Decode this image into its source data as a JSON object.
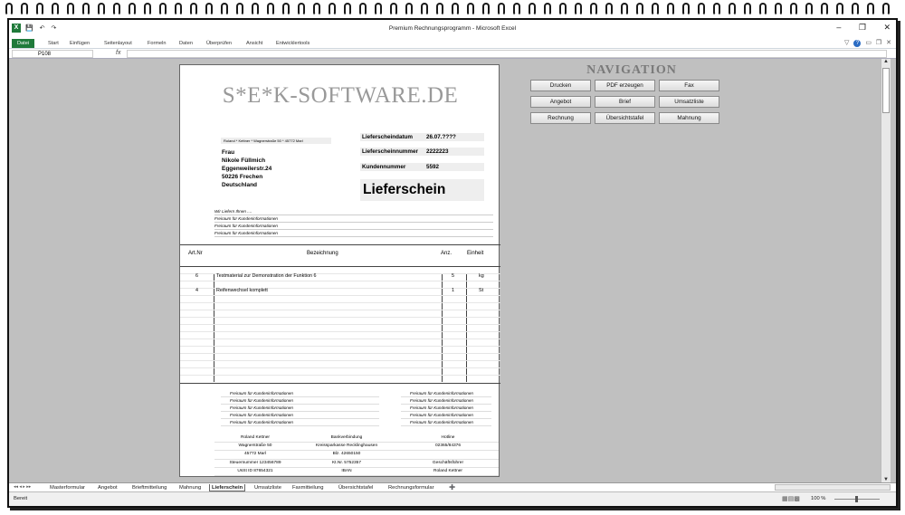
{
  "window": {
    "title": "Premium Rechnungsprogramm  -  Microsoft Excel",
    "app_icon": "X",
    "qat": [
      "save-icon",
      "undo-icon",
      "redo-icon"
    ],
    "controls": [
      "–",
      "❐",
      "✕"
    ]
  },
  "ribbon": {
    "tabs": [
      "Datei",
      "Start",
      "Einfügen",
      "Seitenlayout",
      "Formeln",
      "Daten",
      "Überprüfen",
      "Ansicht",
      "Entwicklertools"
    ],
    "active": "Datei"
  },
  "formula_bar": {
    "name_box": "P108",
    "fx": "fx",
    "value": ""
  },
  "sheet": {
    "logo": "S*E*K-SOFTWARE.DE",
    "sender_line": "Roland * Kettner * Wagnerstraße 50 * 45772 Marl",
    "recipient": [
      "Frau",
      "Nikole Füllmich",
      "Eggenweilerstr.24",
      "50226 Frechen",
      "Deutschland"
    ],
    "info": [
      {
        "label": "Lieferscheindatum",
        "value": "26.07.????"
      },
      {
        "label": "Lieferscheinnummer",
        "value": "2222223"
      },
      {
        "label": "Kundennummer",
        "value": "5592"
      }
    ],
    "doc_type": "Lieferschein",
    "free_lines": [
      "Wir Liefern Ihnen ....",
      "Freiraum für Kundeninformationen",
      "Freiraum für Kundeninformationen",
      "Freiraum für Kundeninformationen"
    ],
    "columns": [
      "Art.Nr",
      "Bezeichnung",
      "Anz.",
      "Einheit"
    ],
    "rows": [
      {
        "art": "6",
        "desc": "Testmaterial zur Demonstration der Funktion 6",
        "qty": "5",
        "unit": "kg"
      },
      {
        "art": "4",
        "desc": "Reifenwechsel komplett",
        "qty": "1",
        "unit": "St"
      }
    ],
    "footer_free_left": [
      "Freiraum für Kundeninformationen",
      "Freiraum für Kundeninformationen",
      "Freiraum für Kundeninformationen",
      "Freiraum für Kundeninformationen",
      "Freiraum für Kundeninformationen"
    ],
    "footer_free_right": [
      "Freiraum für Kundeninformationen",
      "Freiraum für Kundeninformationen",
      "Freiraum für Kundeninformationen",
      "Freiraum für Kundeninformationen",
      "Freiraum für Kundeninformationen"
    ],
    "footer_col1": [
      "Roland Kettner",
      "Wagnerstraße 50",
      "45772 Marl",
      "Steuernummer 123456789",
      "UsSt ID 87654321"
    ],
    "footer_col2": [
      "Bankverbindung",
      "Kreissparkasse Recklinghausen",
      "Blz. 42650150",
      "Kt.Nr. 5752357",
      "IBAN"
    ],
    "footer_col3": [
      "Hotline",
      "02365/84376",
      "",
      "Geschäftsführer",
      "Roland Kettner"
    ]
  },
  "navigation": {
    "title": "NAVIGATION",
    "buttons": [
      "Drucken",
      "PDF erzeugen",
      "Fax",
      "Angebot",
      "Brief",
      "Umsatzliste",
      "Rechnung",
      "Übersichtstafel",
      "Mahnung"
    ]
  },
  "sheet_tabs": {
    "nav": "◂◂ ◂ ▸ ▸▸",
    "tabs": [
      "Masterformular",
      "Angebot",
      "Brieftmitteilung",
      "Mahnung",
      "Lieferschein",
      "Umsatzliste",
      "Faxmitteilung",
      "Übersichtstafel",
      "Rechnungsformular"
    ],
    "active": "Lieferschein"
  },
  "status": {
    "text": "Bereit",
    "zoom": "100 %"
  }
}
